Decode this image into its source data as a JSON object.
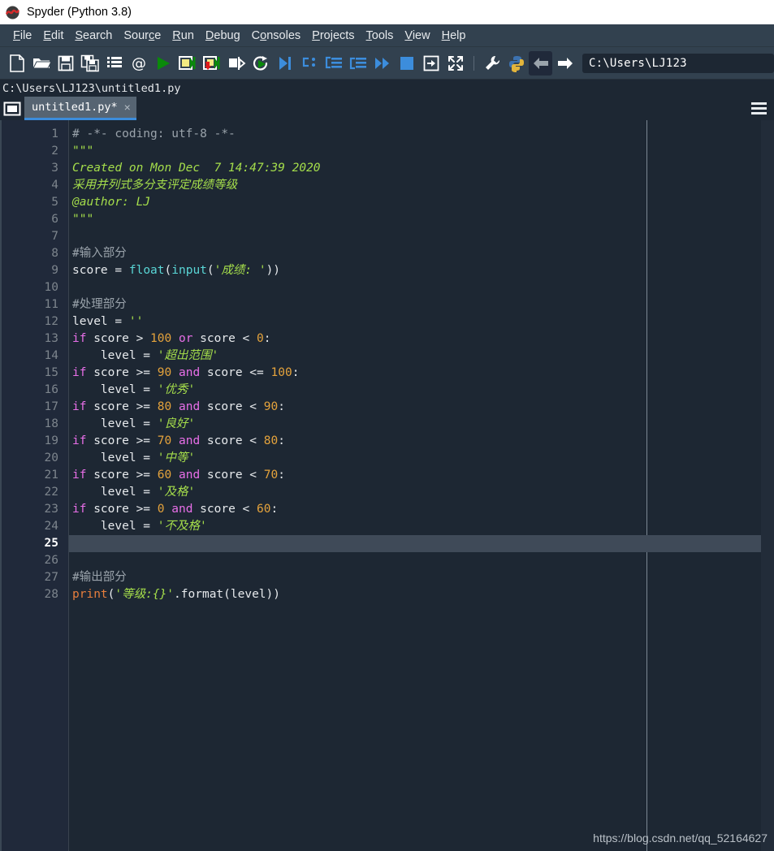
{
  "window": {
    "title": "Spyder (Python 3.8)",
    "icon": "spyder-logo-icon"
  },
  "menubar": {
    "items": [
      {
        "label": "File",
        "mnemonic": "F"
      },
      {
        "label": "Edit",
        "mnemonic": "E"
      },
      {
        "label": "Search",
        "mnemonic": "S"
      },
      {
        "label": "Source",
        "mnemonic": "c"
      },
      {
        "label": "Run",
        "mnemonic": "R"
      },
      {
        "label": "Debug",
        "mnemonic": "D"
      },
      {
        "label": "Consoles",
        "mnemonic": "o"
      },
      {
        "label": "Projects",
        "mnemonic": "P"
      },
      {
        "label": "Tools",
        "mnemonic": "T"
      },
      {
        "label": "View",
        "mnemonic": "V"
      },
      {
        "label": "Help",
        "mnemonic": "H"
      }
    ]
  },
  "toolbar": {
    "buttons": [
      {
        "name": "new-file-icon",
        "title": "New file"
      },
      {
        "name": "open-file-icon",
        "title": "Open file"
      },
      {
        "name": "save-file-icon",
        "title": "Save file"
      },
      {
        "name": "save-all-icon",
        "title": "Save all"
      },
      {
        "name": "file-switcher-icon",
        "title": "File switcher"
      },
      {
        "name": "find-symbol-icon",
        "title": "Symbol finder"
      },
      {
        "name": "run-file-icon",
        "title": "Run file"
      },
      {
        "name": "run-cell-icon",
        "title": "Run current cell"
      },
      {
        "name": "run-cell-advance-icon",
        "title": "Run current cell and go to the next one"
      },
      {
        "name": "run-selection-icon",
        "title": "Run selection or current line"
      },
      {
        "name": "rerun-file-icon",
        "title": "Re-run last script"
      },
      {
        "name": "debug-file-icon",
        "title": "Debug file"
      },
      {
        "name": "step-over-icon",
        "title": "Run current line"
      },
      {
        "name": "step-into-icon",
        "title": "Step into function"
      },
      {
        "name": "step-return-icon",
        "title": "Run until function returns"
      },
      {
        "name": "continue-icon",
        "title": "Continue execution"
      },
      {
        "name": "stop-debug-icon",
        "title": "Stop debugging"
      },
      {
        "name": "exit-debug-icon",
        "title": "Exit debug"
      },
      {
        "name": "maximize-pane-icon",
        "title": "Maximize current pane"
      },
      {
        "name": "preferences-icon",
        "title": "Preferences"
      },
      {
        "name": "pythonpath-icon",
        "title": "PYTHONPATH manager"
      },
      {
        "name": "back-icon",
        "title": "Back"
      },
      {
        "name": "forward-icon",
        "title": "Forward"
      }
    ],
    "path_value": "C:\\Users\\LJ123"
  },
  "pathstrip": {
    "file_path": "C:\\Users\\LJ123\\untitled1.py"
  },
  "tabbar": {
    "browse_icon": "browse-tabs-icon",
    "options_icon": "options-hamburger-icon",
    "tabs": [
      {
        "label": "untitled1.py*",
        "close": "×",
        "active": true
      }
    ]
  },
  "editor": {
    "current_line": 25,
    "total_lines": 28,
    "line_numbers": [
      1,
      2,
      3,
      4,
      5,
      6,
      7,
      8,
      9,
      10,
      11,
      12,
      13,
      14,
      15,
      16,
      17,
      18,
      19,
      20,
      21,
      22,
      23,
      24,
      25,
      26,
      27,
      28
    ],
    "lines": [
      [
        {
          "t": "# -*- coding: utf-8 -*-",
          "c": "cmt"
        }
      ],
      [
        {
          "t": "\"\"\"",
          "c": "str"
        }
      ],
      [
        {
          "t": "Created on Mon Dec  7 14:47:39 2020",
          "c": "str"
        }
      ],
      [
        {
          "t": "采用并列式多分支评定成绩等级",
          "c": "str"
        }
      ],
      [
        {
          "t": "@author: LJ",
          "c": "str"
        }
      ],
      [
        {
          "t": "\"\"\"",
          "c": "str"
        }
      ],
      [],
      [
        {
          "t": "#输入部分",
          "c": "cmt"
        }
      ],
      [
        {
          "t": "score ",
          "c": "pl"
        },
        {
          "t": "=",
          "c": "pl"
        },
        {
          "t": " ",
          "c": "pl"
        },
        {
          "t": "float",
          "c": "fn"
        },
        {
          "t": "(",
          "c": "pl"
        },
        {
          "t": "input",
          "c": "fn"
        },
        {
          "t": "(",
          "c": "pl"
        },
        {
          "t": "'成绩: '",
          "c": "str"
        },
        {
          "t": "))",
          "c": "pl"
        }
      ],
      [],
      [
        {
          "t": "#处理部分",
          "c": "cmt"
        }
      ],
      [
        {
          "t": "level = ",
          "c": "pl"
        },
        {
          "t": "''",
          "c": "str"
        }
      ],
      [
        {
          "t": "if",
          "c": "kw"
        },
        {
          "t": " score > ",
          "c": "pl"
        },
        {
          "t": "100",
          "c": "num"
        },
        {
          "t": " ",
          "c": "pl"
        },
        {
          "t": "or",
          "c": "kw"
        },
        {
          "t": " score < ",
          "c": "pl"
        },
        {
          "t": "0",
          "c": "num"
        },
        {
          "t": ":",
          "c": "pl"
        }
      ],
      [
        {
          "t": "    level = ",
          "c": "pl"
        },
        {
          "t": "'超出范围'",
          "c": "str"
        }
      ],
      [
        {
          "t": "if",
          "c": "kw"
        },
        {
          "t": " score >= ",
          "c": "pl"
        },
        {
          "t": "90",
          "c": "num"
        },
        {
          "t": " ",
          "c": "pl"
        },
        {
          "t": "and",
          "c": "kw"
        },
        {
          "t": " score <= ",
          "c": "pl"
        },
        {
          "t": "100",
          "c": "num"
        },
        {
          "t": ":",
          "c": "pl"
        }
      ],
      [
        {
          "t": "    level = ",
          "c": "pl"
        },
        {
          "t": "'优秀'",
          "c": "str"
        }
      ],
      [
        {
          "t": "if",
          "c": "kw"
        },
        {
          "t": " score >= ",
          "c": "pl"
        },
        {
          "t": "80",
          "c": "num"
        },
        {
          "t": " ",
          "c": "pl"
        },
        {
          "t": "and",
          "c": "kw"
        },
        {
          "t": " score < ",
          "c": "pl"
        },
        {
          "t": "90",
          "c": "num"
        },
        {
          "t": ":",
          "c": "pl"
        }
      ],
      [
        {
          "t": "    level = ",
          "c": "pl"
        },
        {
          "t": "'良好'",
          "c": "str"
        }
      ],
      [
        {
          "t": "if",
          "c": "kw"
        },
        {
          "t": " score >= ",
          "c": "pl"
        },
        {
          "t": "70",
          "c": "num"
        },
        {
          "t": " ",
          "c": "pl"
        },
        {
          "t": "and",
          "c": "kw"
        },
        {
          "t": " score < ",
          "c": "pl"
        },
        {
          "t": "80",
          "c": "num"
        },
        {
          "t": ":",
          "c": "pl"
        }
      ],
      [
        {
          "t": "    level = ",
          "c": "pl"
        },
        {
          "t": "'中等'",
          "c": "str"
        }
      ],
      [
        {
          "t": "if",
          "c": "kw"
        },
        {
          "t": " score >= ",
          "c": "pl"
        },
        {
          "t": "60",
          "c": "num"
        },
        {
          "t": " ",
          "c": "pl"
        },
        {
          "t": "and",
          "c": "kw"
        },
        {
          "t": " score < ",
          "c": "pl"
        },
        {
          "t": "70",
          "c": "num"
        },
        {
          "t": ":",
          "c": "pl"
        }
      ],
      [
        {
          "t": "    level = ",
          "c": "pl"
        },
        {
          "t": "'及格'",
          "c": "str"
        }
      ],
      [
        {
          "t": "if",
          "c": "kw"
        },
        {
          "t": " score >= ",
          "c": "pl"
        },
        {
          "t": "0",
          "c": "num"
        },
        {
          "t": " ",
          "c": "pl"
        },
        {
          "t": "and",
          "c": "kw"
        },
        {
          "t": " score < ",
          "c": "pl"
        },
        {
          "t": "60",
          "c": "num"
        },
        {
          "t": ":",
          "c": "pl"
        }
      ],
      [
        {
          "t": "    level = ",
          "c": "pl"
        },
        {
          "t": "'不及格'",
          "c": "str"
        }
      ],
      [],
      [],
      [
        {
          "t": "#输出部分",
          "c": "cmt"
        }
      ],
      [
        {
          "t": "print",
          "c": "bi"
        },
        {
          "t": "(",
          "c": "pl"
        },
        {
          "t": "'等级:{}'",
          "c": "str"
        },
        {
          "t": ".format(level))",
          "c": "pl"
        }
      ]
    ]
  },
  "watermark": {
    "text": "https://blog.csdn.net/qq_52164627"
  },
  "colors": {
    "menubar_bg": "#32414f",
    "editor_bg": "#1d2733",
    "gutter_bg": "#20293a",
    "current_line_bg": "#3f4a58",
    "tab_active_underline": "#3c8ddc",
    "comment": "#9aa3ab",
    "string": "#a5de4b",
    "keyword": "#e86fe8",
    "number": "#e5a33c",
    "builtin": "#e67e3d",
    "function": "#59d6d6"
  }
}
